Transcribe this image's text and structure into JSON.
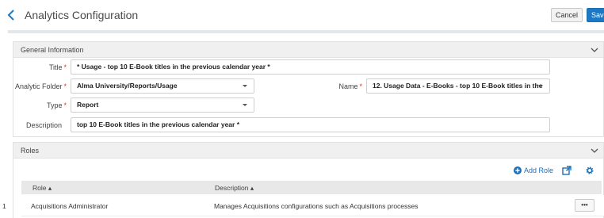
{
  "header": {
    "title": "Analytics Configuration",
    "cancel_label": "Cancel",
    "save_label": "Save"
  },
  "general": {
    "section_title": "General Information",
    "title_label": "Title",
    "title_value": "* Usage - top 10 E-Book titles in the previous calendar year *",
    "folder_label": "Analytic Folder",
    "folder_value": "Alma University/Reports/Usage",
    "name_label": "Name",
    "name_value": "12. Usage Data - E-Books - top 10 E-Book titles in the",
    "type_label": "Type",
    "type_value": "Report",
    "description_label": "Description",
    "description_value": "top 10 E-Book titles in the previous calendar year *",
    "required_mark": "*"
  },
  "roles": {
    "section_title": "Roles",
    "add_role_label": "Add Role",
    "columns": {
      "role": "Role ▴",
      "description": "Description ▴"
    },
    "rows": [
      {
        "index": "1",
        "role": "Acquisitions Administrator",
        "description": "Manages Acquisitions configurations such as Acquisitions processes",
        "actions_label": "•••"
      }
    ]
  },
  "colors": {
    "accent": "#1c78c4",
    "required": "#d32f2f",
    "link": "#1c6fb8"
  },
  "icons": [
    "chevron-left-icon",
    "chevron-down-icon",
    "plus-circle-icon",
    "external-link-icon",
    "gear-icon"
  ]
}
